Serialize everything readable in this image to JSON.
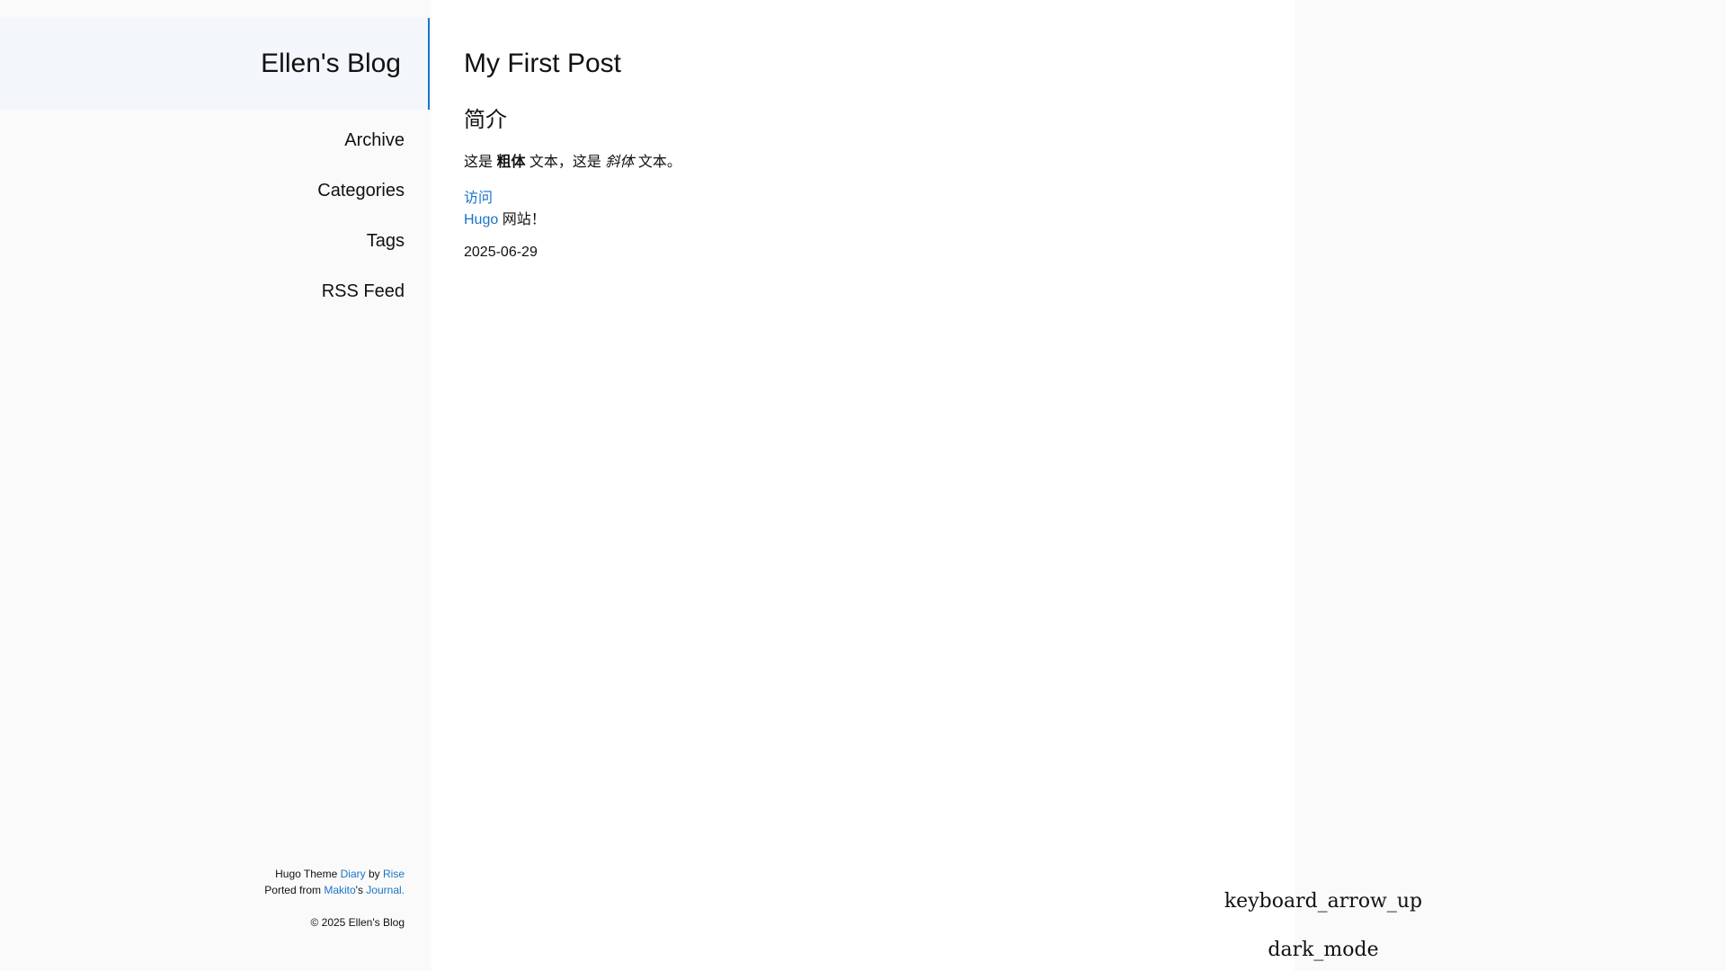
{
  "sidebar": {
    "brand": "Ellen's Blog",
    "nav": [
      {
        "label": "Archive"
      },
      {
        "label": "Categories"
      },
      {
        "label": "Tags"
      },
      {
        "label": "RSS Feed"
      }
    ],
    "footer": {
      "line1_prefix": "Hugo Theme ",
      "line1_link1": "Diary",
      "line1_mid": " by ",
      "line1_link2": "Rise",
      "line2_prefix": "Ported from ",
      "line2_link1": "Makito",
      "line2_mid": "'s ",
      "line2_link2": "Journal.",
      "copyright": "© 2025 Ellen's Blog"
    }
  },
  "post": {
    "title": "My First Post",
    "section_heading": "简介",
    "p1_a": "这是 ",
    "p1_bold": "粗体",
    "p1_b": " 文本，这是 ",
    "p1_italic": "斜体",
    "p1_c": " 文本。",
    "visit_link": "访问",
    "hugo_link": "Hugo",
    "site_suffix": " 网站！",
    "date": "2025-06-29"
  },
  "floating": {
    "up_icon_text": "keyboard_arrow_up",
    "dark_icon_text": "dark_mode"
  },
  "colors": {
    "accent": "#1a73c8",
    "sidebar_bg": "#fafafa",
    "brand_bg": "#f3f7fb"
  }
}
